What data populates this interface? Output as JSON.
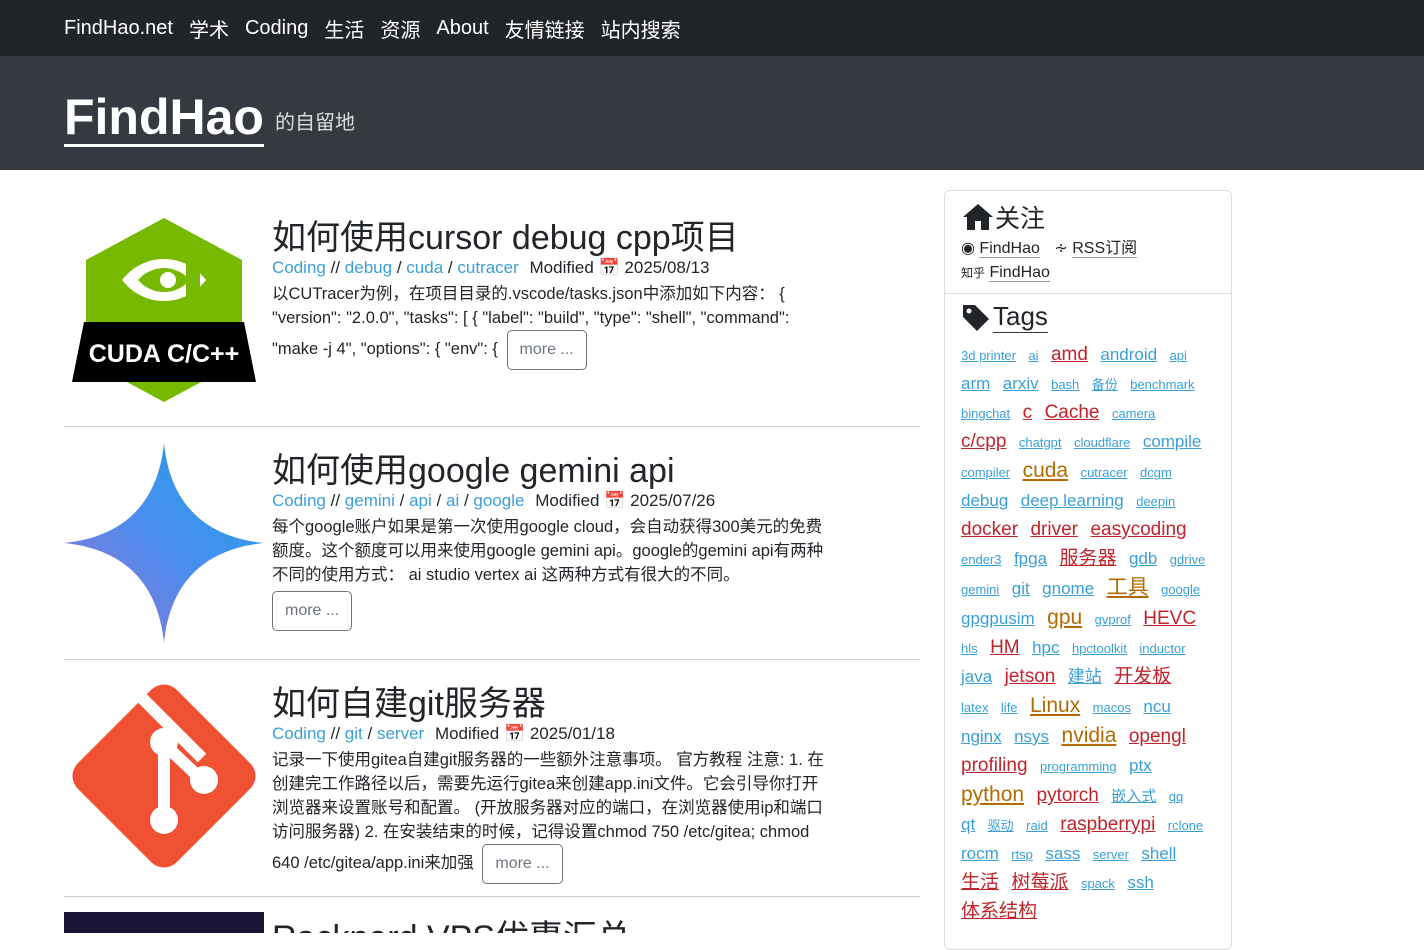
{
  "nav": {
    "items": [
      "FindHao.net",
      "学术",
      "Coding",
      "生活",
      "资源",
      "About",
      "友情链接",
      "站内搜索"
    ]
  },
  "header": {
    "brand": "FindHao",
    "tagline": "的自留地"
  },
  "posts": [
    {
      "title": "如何使用cursor debug cpp项目",
      "category": "Coding",
      "tags": [
        "debug",
        "cuda",
        "cutracer"
      ],
      "modified_label": "Modified",
      "date": "2025/08/13",
      "thumb_text": "CUDA C/C++",
      "excerpt": "以CUTracer为例，在项目目录的.vscode/tasks.json中添加如下内容： { \"version\": \"2.0.0\", \"tasks\": [ { \"label\": \"build\", \"type\": \"shell\", \"command\": \"make -j 4\", \"options\": { \"env\": {",
      "more": "more ..."
    },
    {
      "title": "如何使用google gemini api",
      "category": "Coding",
      "tags": [
        "gemini",
        "api",
        "ai",
        "google"
      ],
      "modified_label": "Modified",
      "date": "2025/07/26",
      "excerpt": "每个google账户如果是第一次使用google cloud，会自动获得300美元的免费额度。这个额度可以用来使用google gemini api。google的gemini api有两种不同的使用方式： ai studio vertex ai 这两种方式有很大的不同。",
      "more": "more ..."
    },
    {
      "title": "如何自建git服务器",
      "category": "Coding",
      "tags": [
        "git",
        "server"
      ],
      "modified_label": "Modified",
      "date": "2025/01/18",
      "excerpt": "记录一下使用gitea自建git服务器的一些额外注意事项。 官方教程 注意: 1. 在创建完工作路径以后，需要先运行gitea来创建app.ini文件。它会引导你打开浏览器来设置账号和配置。 (开放服务器对应的端口，在浏览器使用ip和端口访问服务器) 2. 在安装结束的时候，记得设置chmod 750 /etc/gitea; chmod 640 /etc/gitea/app.ini来加强",
      "more": "more ..."
    },
    {
      "title": "Racknerd VPS优惠汇总"
    }
  ],
  "sidebar": {
    "follow_title": "关注",
    "github": "FindHao",
    "rss": "RSS订阅",
    "zhihu_prefix": "知乎",
    "zhihu": "FindHao",
    "tags_title": "Tags",
    "tags": [
      {
        "t": "3d printer",
        "s": 13,
        "c": "#3a9fd6"
      },
      {
        "t": "ai",
        "s": 13,
        "c": "#3a9fd6"
      },
      {
        "t": "amd",
        "s": 19,
        "c": "#c0242b"
      },
      {
        "t": "android",
        "s": 17,
        "c": "#3a9fd6"
      },
      {
        "t": "api",
        "s": 13,
        "c": "#3a9fd6"
      },
      {
        "t": "arm",
        "s": 17,
        "c": "#3a9fd6"
      },
      {
        "t": "arxiv",
        "s": 17,
        "c": "#3a9fd6"
      },
      {
        "t": "bash",
        "s": 13,
        "c": "#3a9fd6"
      },
      {
        "t": "备份",
        "s": 13,
        "c": "#3a9fd6"
      },
      {
        "t": "benchmark",
        "s": 13,
        "c": "#3a9fd6"
      },
      {
        "t": "bingchat",
        "s": 13,
        "c": "#3a9fd6"
      },
      {
        "t": "c",
        "s": 19,
        "c": "#c0242b"
      },
      {
        "t": "Cache",
        "s": 19,
        "c": "#c0242b"
      },
      {
        "t": "camera",
        "s": 13,
        "c": "#3a9fd6"
      },
      {
        "t": "c/cpp",
        "s": 19,
        "c": "#c0242b"
      },
      {
        "t": "chatgpt",
        "s": 13,
        "c": "#3a9fd6"
      },
      {
        "t": "cloudflare",
        "s": 13,
        "c": "#3a9fd6"
      },
      {
        "t": "compile",
        "s": 17,
        "c": "#3a9fd6"
      },
      {
        "t": "compiler",
        "s": 13,
        "c": "#3a9fd6"
      },
      {
        "t": "cuda",
        "s": 21,
        "c": "#b36a00"
      },
      {
        "t": "cutracer",
        "s": 13,
        "c": "#3a9fd6"
      },
      {
        "t": "dcgm",
        "s": 13,
        "c": "#3a9fd6"
      },
      {
        "t": "debug",
        "s": 17,
        "c": "#3a9fd6"
      },
      {
        "t": "deep learning",
        "s": 17,
        "c": "#3a9fd6"
      },
      {
        "t": "deepin",
        "s": 13,
        "c": "#3a9fd6"
      },
      {
        "t": "docker",
        "s": 19,
        "c": "#c0242b"
      },
      {
        "t": "driver",
        "s": 19,
        "c": "#c0242b"
      },
      {
        "t": "easycoding",
        "s": 19,
        "c": "#c0242b"
      },
      {
        "t": "ender3",
        "s": 13,
        "c": "#3a9fd6"
      },
      {
        "t": "fpga",
        "s": 17,
        "c": "#3a9fd6"
      },
      {
        "t": "服务器",
        "s": 19,
        "c": "#c0242b"
      },
      {
        "t": "gdb",
        "s": 17,
        "c": "#3a9fd6"
      },
      {
        "t": "gdrive",
        "s": 13,
        "c": "#3a9fd6"
      },
      {
        "t": "gemini",
        "s": 13,
        "c": "#3a9fd6"
      },
      {
        "t": "git",
        "s": 17,
        "c": "#3a9fd6"
      },
      {
        "t": "gnome",
        "s": 17,
        "c": "#3a9fd6"
      },
      {
        "t": "工具",
        "s": 21,
        "c": "#b36a00"
      },
      {
        "t": "google",
        "s": 13,
        "c": "#3a9fd6"
      },
      {
        "t": "gpgpusim",
        "s": 17,
        "c": "#3a9fd6"
      },
      {
        "t": "gpu",
        "s": 21,
        "c": "#b36a00"
      },
      {
        "t": "gvprof",
        "s": 13,
        "c": "#3a9fd6"
      },
      {
        "t": "HEVC",
        "s": 19,
        "c": "#c0242b"
      },
      {
        "t": "hls",
        "s": 13,
        "c": "#3a9fd6"
      },
      {
        "t": "HM",
        "s": 19,
        "c": "#c0242b"
      },
      {
        "t": "hpc",
        "s": 17,
        "c": "#3a9fd6"
      },
      {
        "t": "hpctoolkit",
        "s": 13,
        "c": "#3a9fd6"
      },
      {
        "t": "inductor",
        "s": 13,
        "c": "#3a9fd6"
      },
      {
        "t": "java",
        "s": 17,
        "c": "#3a9fd6"
      },
      {
        "t": "jetson",
        "s": 19,
        "c": "#c0242b"
      },
      {
        "t": "建站",
        "s": 17,
        "c": "#3a9fd6"
      },
      {
        "t": "开发板",
        "s": 19,
        "c": "#c0242b"
      },
      {
        "t": "latex",
        "s": 13,
        "c": "#3a9fd6"
      },
      {
        "t": "life",
        "s": 13,
        "c": "#3a9fd6"
      },
      {
        "t": "Linux",
        "s": 21,
        "c": "#b36a00"
      },
      {
        "t": "macos",
        "s": 13,
        "c": "#3a9fd6"
      },
      {
        "t": "ncu",
        "s": 17,
        "c": "#3a9fd6"
      },
      {
        "t": "nginx",
        "s": 17,
        "c": "#3a9fd6"
      },
      {
        "t": "nsys",
        "s": 17,
        "c": "#3a9fd6"
      },
      {
        "t": "nvidia",
        "s": 21,
        "c": "#b36a00"
      },
      {
        "t": "opengl",
        "s": 19,
        "c": "#c0242b"
      },
      {
        "t": "profiling",
        "s": 19,
        "c": "#c0242b"
      },
      {
        "t": "programming",
        "s": 13,
        "c": "#3a9fd6"
      },
      {
        "t": "ptx",
        "s": 17,
        "c": "#3a9fd6"
      },
      {
        "t": "python",
        "s": 21,
        "c": "#b36a00"
      },
      {
        "t": "pytorch",
        "s": 19,
        "c": "#c0242b"
      },
      {
        "t": "嵌入式",
        "s": 15,
        "c": "#3a9fd6"
      },
      {
        "t": "qq",
        "s": 13,
        "c": "#3a9fd6"
      },
      {
        "t": "qt",
        "s": 17,
        "c": "#3a9fd6"
      },
      {
        "t": "驱动",
        "s": 13,
        "c": "#3a9fd6"
      },
      {
        "t": "raid",
        "s": 13,
        "c": "#3a9fd6"
      },
      {
        "t": "raspberrypi",
        "s": 19,
        "c": "#c0242b"
      },
      {
        "t": "rclone",
        "s": 13,
        "c": "#3a9fd6"
      },
      {
        "t": "rocm",
        "s": 17,
        "c": "#3a9fd6"
      },
      {
        "t": "rtsp",
        "s": 13,
        "c": "#3a9fd6"
      },
      {
        "t": "sass",
        "s": 17,
        "c": "#3a9fd6"
      },
      {
        "t": "server",
        "s": 13,
        "c": "#3a9fd6"
      },
      {
        "t": "shell",
        "s": 17,
        "c": "#3a9fd6"
      },
      {
        "t": "生活",
        "s": 19,
        "c": "#c0242b"
      },
      {
        "t": "树莓派",
        "s": 19,
        "c": "#c0242b"
      },
      {
        "t": "spack",
        "s": 13,
        "c": "#3a9fd6"
      },
      {
        "t": "ssh",
        "s": 17,
        "c": "#3a9fd6"
      },
      {
        "t": "体系结构",
        "s": 19,
        "c": "#c0242b"
      }
    ]
  }
}
